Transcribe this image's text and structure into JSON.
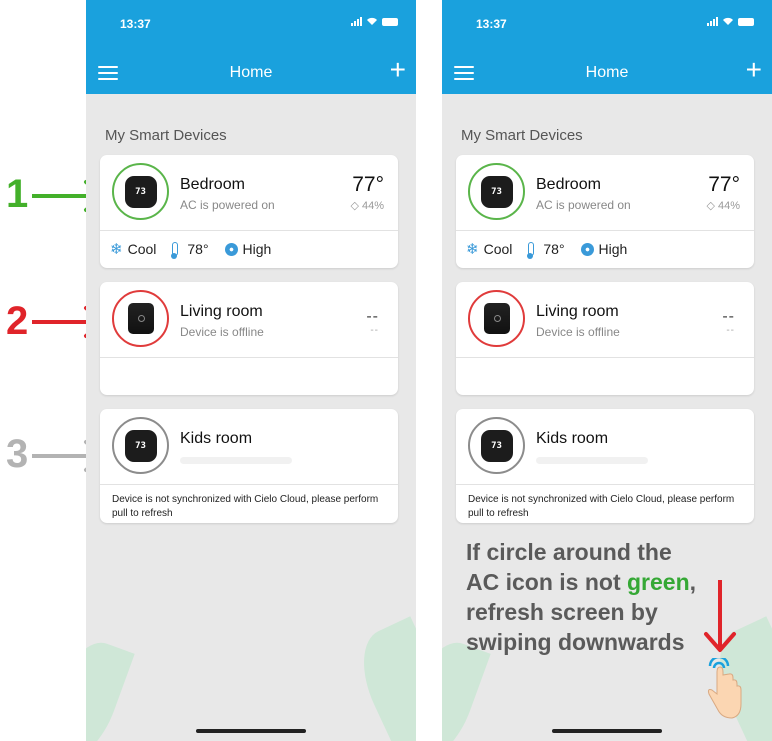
{
  "status_time": "13:37",
  "header": {
    "title": "Home",
    "add_label": "+"
  },
  "section_title": "My Smart Devices",
  "devices": [
    {
      "name": "Bedroom",
      "status": "AC is powered on",
      "temperature": "77°",
      "humidity": "44%",
      "circle_color": "#5ab54a",
      "display": "73",
      "mode": "Cool",
      "setpoint": "78°",
      "fan": "High"
    },
    {
      "name": "Living room",
      "status": "Device is offline",
      "temperature": "--",
      "humidity": "--",
      "circle_color": "#e03b3b"
    },
    {
      "name": "Kids room",
      "status": "",
      "circle_color": "#8c8c8c",
      "display": "73",
      "sync_message": "Device is not synchronized with Cielo Cloud, please perform pull to refresh"
    }
  ],
  "annotations": [
    {
      "number": "1",
      "color": "#43b02a"
    },
    {
      "number": "2",
      "color": "#e0242a"
    },
    {
      "number": "3",
      "color": "#b3b3b3"
    }
  ],
  "instruction": {
    "part1": "If circle around the AC icon is not ",
    "green_word": "green",
    "part2": ", refresh screen by swiping downwards"
  },
  "icons": [
    "menu-icon",
    "plus-icon",
    "snowflake-icon",
    "thermometer-icon",
    "fan-icon",
    "droplet-icon",
    "down-arrow-icon",
    "hand-icon"
  ]
}
